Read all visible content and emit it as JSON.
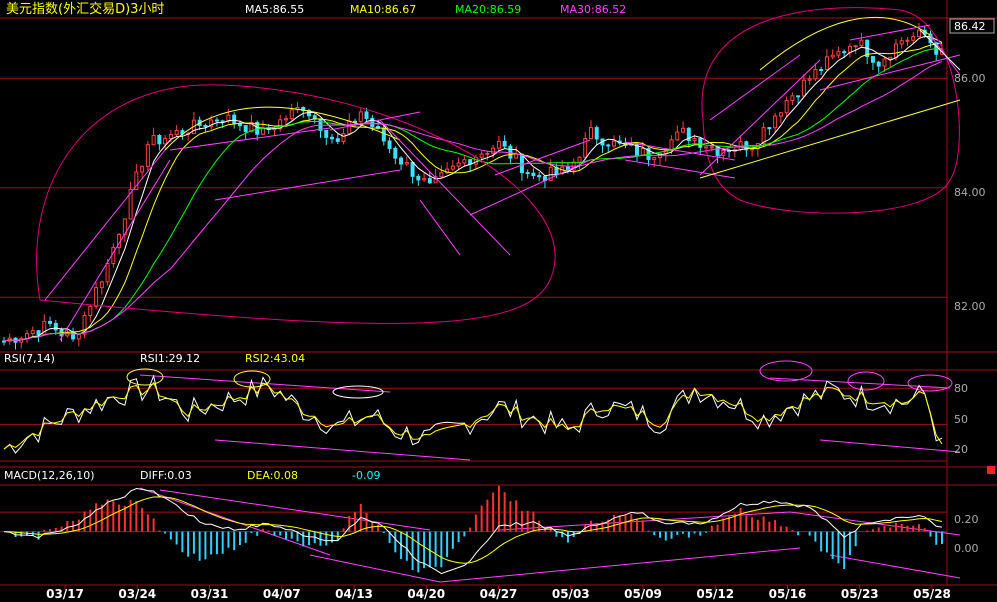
{
  "chart_data": [
    {
      "type": "candlestick",
      "title": "美元指数(外汇交易D)3小时",
      "legend": [
        {
          "label": "MA5:86.55",
          "color": "#ffffff"
        },
        {
          "label": "MA10:86.67",
          "color": "#ffff00"
        },
        {
          "label": "MA20:86.59",
          "color": "#00ff00"
        },
        {
          "label": "MA30:86.52",
          "color": "#ff00ff"
        }
      ],
      "ylim": [
        81.0,
        87.1
      ],
      "yticks": [
        {
          "value": 86.0,
          "label": "86.00"
        },
        {
          "value": 84.0,
          "label": "84.00"
        },
        {
          "value": 82.0,
          "label": "82.00"
        }
      ],
      "last_price": "86.42",
      "x_categories": [
        "03/17",
        "03/24",
        "03/31",
        "04/07",
        "04/13",
        "04/20",
        "04/27",
        "05/03",
        "05/09",
        "05/12",
        "05/16",
        "05/23",
        "05/28"
      ],
      "price_path": [
        [
          0,
          81.2
        ],
        [
          8,
          81.5
        ],
        [
          12,
          81.2
        ],
        [
          18,
          82.6
        ],
        [
          25,
          84.8
        ],
        [
          30,
          85.0
        ],
        [
          38,
          85.3
        ],
        [
          45,
          85.0
        ],
        [
          52,
          85.5
        ],
        [
          58,
          84.8
        ],
        [
          62,
          85.4
        ],
        [
          68,
          84.6
        ],
        [
          74,
          84.0
        ],
        [
          80,
          84.5
        ],
        [
          86,
          84.8
        ],
        [
          92,
          84.2
        ],
        [
          98,
          84.3
        ],
        [
          102,
          85.0
        ],
        [
          106,
          84.8
        ],
        [
          112,
          84.6
        ],
        [
          118,
          85.0
        ],
        [
          124,
          84.7
        ],
        [
          130,
          84.8
        ],
        [
          136,
          85.6
        ],
        [
          142,
          86.2
        ],
        [
          148,
          86.7
        ],
        [
          152,
          86.3
        ],
        [
          156,
          86.7
        ],
        [
          160,
          86.8
        ],
        [
          163,
          86.4
        ]
      ]
    },
    {
      "type": "line",
      "title": "RSI(7,14)",
      "series": [
        {
          "name": "RSI1",
          "label": "RSI1:29.12",
          "color": "#ffffff"
        },
        {
          "name": "RSI2",
          "label": "RSI2:43.04",
          "color": "#ffff00"
        }
      ],
      "ylim": [
        15,
        95
      ],
      "yticks": [
        {
          "value": 80,
          "label": "80"
        },
        {
          "value": 50,
          "label": "50"
        },
        {
          "value": 20,
          "label": "20"
        }
      ],
      "rsi_path": [
        [
          0,
          30
        ],
        [
          10,
          55
        ],
        [
          20,
          75
        ],
        [
          26,
          80
        ],
        [
          32,
          60
        ],
        [
          40,
          72
        ],
        [
          46,
          82
        ],
        [
          52,
          62
        ],
        [
          58,
          48
        ],
        [
          64,
          58
        ],
        [
          68,
          45
        ],
        [
          74,
          38
        ],
        [
          80,
          50
        ],
        [
          86,
          65
        ],
        [
          92,
          55
        ],
        [
          98,
          45
        ],
        [
          104,
          66
        ],
        [
          110,
          60
        ],
        [
          114,
          52
        ],
        [
          120,
          80
        ],
        [
          126,
          70
        ],
        [
          132,
          55
        ],
        [
          138,
          68
        ],
        [
          144,
          78
        ],
        [
          150,
          72
        ],
        [
          156,
          68
        ],
        [
          160,
          75
        ],
        [
          163,
          30
        ]
      ]
    },
    {
      "type": "bar",
      "title": "MACD(12,26,10)",
      "series": [
        {
          "name": "DIFF",
          "label": "DIFF:0.03",
          "color": "#ffffff"
        },
        {
          "name": "DEA",
          "label": "DEA:0.08",
          "color": "#ffff00"
        },
        {
          "name": "MACD",
          "label": "-0.09",
          "color": "#00ffff"
        }
      ],
      "ylim": [
        -0.55,
        0.48
      ],
      "yticks": [
        {
          "value": 0.2,
          "label": "0.20"
        },
        {
          "value": 0.0,
          "label": "0.00"
        }
      ],
      "diff_path": [
        [
          0,
          0.0
        ],
        [
          6,
          -0.05
        ],
        [
          12,
          0.05
        ],
        [
          18,
          0.3
        ],
        [
          24,
          0.45
        ],
        [
          28,
          0.35
        ],
        [
          34,
          0.1
        ],
        [
          40,
          0.02
        ],
        [
          46,
          0.08
        ],
        [
          52,
          -0.03
        ],
        [
          58,
          -0.1
        ],
        [
          62,
          0.15
        ],
        [
          66,
          0.05
        ],
        [
          72,
          -0.3
        ],
        [
          76,
          -0.45
        ],
        [
          80,
          -0.35
        ],
        [
          86,
          0.05
        ],
        [
          92,
          0.1
        ],
        [
          98,
          -0.05
        ],
        [
          104,
          0.1
        ],
        [
          110,
          0.2
        ],
        [
          116,
          0.08
        ],
        [
          122,
          0.1
        ],
        [
          128,
          0.28
        ],
        [
          134,
          0.32
        ],
        [
          140,
          0.25
        ],
        [
          146,
          -0.05
        ],
        [
          150,
          0.1
        ],
        [
          156,
          0.15
        ],
        [
          160,
          0.15
        ],
        [
          163,
          0.03
        ]
      ]
    }
  ]
}
